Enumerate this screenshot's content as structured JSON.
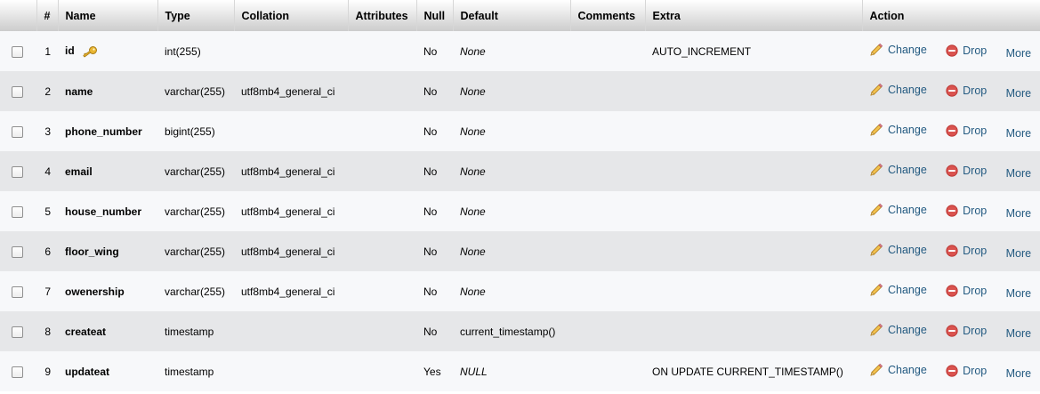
{
  "header": {
    "hash": "#",
    "name": "Name",
    "type": "Type",
    "collation": "Collation",
    "attributes": "Attributes",
    "null": "Null",
    "default": "Default",
    "comments": "Comments",
    "extra": "Extra",
    "action": "Action"
  },
  "actions": {
    "change": "Change",
    "drop": "Drop",
    "more": "More"
  },
  "icons": {
    "primary_key": "key-icon",
    "change": "pencil-icon",
    "drop": "drop-icon"
  },
  "colors": {
    "link": "#235a81",
    "row_odd": "#f7f8fa",
    "row_even": "#e6e7e9",
    "drop_red": "#d9534f",
    "key_gold": "#d4a017"
  },
  "rows": [
    {
      "num": "1",
      "name": "id",
      "primary": true,
      "type": "int(255)",
      "collation": "",
      "attributes": "",
      "null": "No",
      "default": "None",
      "default_italic": true,
      "comments": "",
      "extra": "AUTO_INCREMENT"
    },
    {
      "num": "2",
      "name": "name",
      "primary": false,
      "type": "varchar(255)",
      "collation": "utf8mb4_general_ci",
      "attributes": "",
      "null": "No",
      "default": "None",
      "default_italic": true,
      "comments": "",
      "extra": ""
    },
    {
      "num": "3",
      "name": "phone_number",
      "primary": false,
      "type": "bigint(255)",
      "collation": "",
      "attributes": "",
      "null": "No",
      "default": "None",
      "default_italic": true,
      "comments": "",
      "extra": ""
    },
    {
      "num": "4",
      "name": "email",
      "primary": false,
      "type": "varchar(255)",
      "collation": "utf8mb4_general_ci",
      "attributes": "",
      "null": "No",
      "default": "None",
      "default_italic": true,
      "comments": "",
      "extra": ""
    },
    {
      "num": "5",
      "name": "house_number",
      "primary": false,
      "type": "varchar(255)",
      "collation": "utf8mb4_general_ci",
      "attributes": "",
      "null": "No",
      "default": "None",
      "default_italic": true,
      "comments": "",
      "extra": ""
    },
    {
      "num": "6",
      "name": "floor_wing",
      "primary": false,
      "type": "varchar(255)",
      "collation": "utf8mb4_general_ci",
      "attributes": "",
      "null": "No",
      "default": "None",
      "default_italic": true,
      "comments": "",
      "extra": ""
    },
    {
      "num": "7",
      "name": "owenership",
      "primary": false,
      "type": "varchar(255)",
      "collation": "utf8mb4_general_ci",
      "attributes": "",
      "null": "No",
      "default": "None",
      "default_italic": true,
      "comments": "",
      "extra": ""
    },
    {
      "num": "8",
      "name": "createat",
      "primary": false,
      "type": "timestamp",
      "collation": "",
      "attributes": "",
      "null": "No",
      "default": "current_timestamp()",
      "default_italic": false,
      "comments": "",
      "extra": ""
    },
    {
      "num": "9",
      "name": "updateat",
      "primary": false,
      "type": "timestamp",
      "collation": "",
      "attributes": "",
      "null": "Yes",
      "default": "NULL",
      "default_italic": true,
      "comments": "",
      "extra": "ON UPDATE CURRENT_TIMESTAMP()"
    }
  ]
}
